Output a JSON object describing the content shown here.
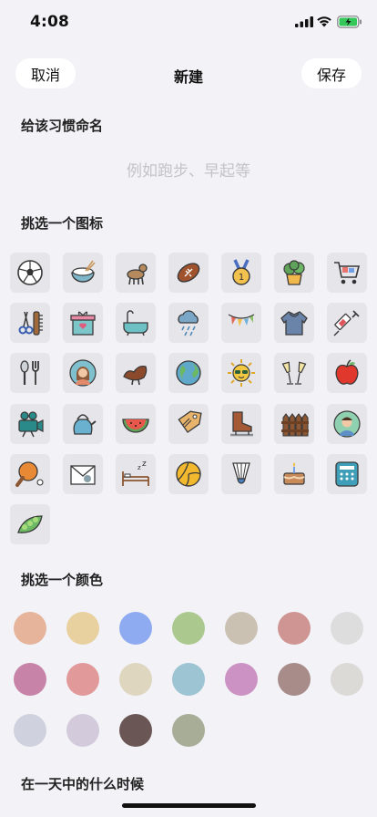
{
  "status_bar": {
    "time": "4:08"
  },
  "nav": {
    "cancel_label": "取消",
    "title": "新建",
    "save_label": "保存"
  },
  "name_section": {
    "heading": "给该习惯命名",
    "placeholder": "例如跑步、早起等",
    "value": ""
  },
  "icon_section": {
    "heading": "挑选一个图标",
    "icons": [
      "soccer-ball-icon",
      "rice-bowl-icon",
      "dog-icon",
      "football-icon",
      "medal-icon",
      "potted-plant-icon",
      "shopping-cart-icon",
      "scissors-comb-icon",
      "gift-box-icon",
      "bathtub-icon",
      "rain-cloud-icon",
      "bunting-icon",
      "sweater-icon",
      "syringe-icon",
      "utensils-icon",
      "woman-avatar-icon",
      "saddle-icon",
      "globe-icon",
      "sun-sunglasses-icon",
      "champagne-glasses-icon",
      "apple-icon",
      "video-camera-icon",
      "kettle-icon",
      "watermelon-icon",
      "price-tag-icon",
      "ice-skate-icon",
      "fence-icon",
      "man-avatar-icon",
      "ping-pong-icon",
      "mail-envelope-icon",
      "bed-sleep-icon",
      "volleyball-icon",
      "shuttlecock-icon",
      "cake-icon",
      "telephone-icon",
      "pea-pod-icon"
    ]
  },
  "color_section": {
    "heading": "挑选一个颜色",
    "colors": [
      "#e5b49a",
      "#e8d19f",
      "#8eaaf0",
      "#abc98f",
      "#cbc1b3",
      "#cf9593",
      "#dddddd",
      "#c883a8",
      "#e2999a",
      "#ded6be",
      "#9cc4d3",
      "#cd92c4",
      "#a78c89",
      "#dcdad6",
      "#cfd1de",
      "#d3cadc",
      "#6b5656",
      "#a8ad98"
    ]
  },
  "time_section": {
    "heading": "在一天中的什么时候"
  }
}
